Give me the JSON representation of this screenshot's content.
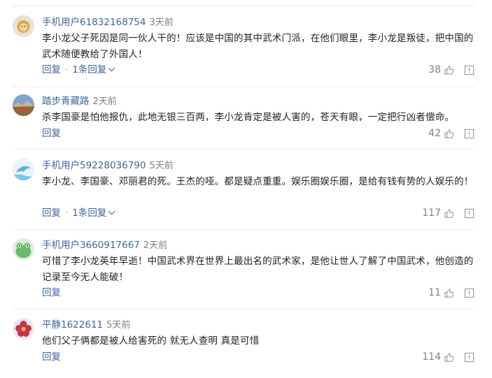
{
  "colors": {
    "link": "#406599",
    "meta": "#7f7f7f",
    "text": "#222222",
    "separator": "#ececec"
  },
  "comments": [
    {
      "user": "手机用户61832168754",
      "time": "3天前",
      "avatar_icon": "lion-avatar-icon",
      "text": "李小龙父子死因是同一伙人干的！应该是中国的其中武术门派，在他们眼里，李小龙是叛徒，把中国的武术随便教给了外国人！",
      "reply_label": "回复",
      "replies_label": "1条回复",
      "likes": "38"
    },
    {
      "user": "踏步青藏路",
      "time": "2天前",
      "avatar_icon": "landscape-avatar-icon",
      "text": "杀李国豪是怕他报仇，此地无银三百两，李小龙肯定是被人害的，苍天有眼，一定把行凶者偿命。",
      "reply_label": "回复",
      "replies_label": "",
      "likes": "42"
    },
    {
      "user": "手机用户59228036790",
      "time": "5天前",
      "avatar_icon": "dolphin-avatar-icon",
      "text": "李小龙、李国豪、邓丽君的死。王杰的哑。都是疑点重重。娱乐圈娱乐圈，是给有钱有势的人娱乐的！",
      "reply_label": "回复",
      "replies_label": "1条回复",
      "likes": "117"
    },
    {
      "user": "手机用户3660917667",
      "time": "2天前",
      "avatar_icon": "frog-avatar-icon",
      "text": "可惜了李小龙英年早逝！中国武术界在世界上最出名的武术家，是他让世人了解了中国武术，他创造的记录至今无人能破！",
      "reply_label": "回复",
      "replies_label": "",
      "likes": "11"
    },
    {
      "user": "平静1622611",
      "time": "5天前",
      "avatar_icon": "flower-avatar-icon",
      "text": "他们父子俩都是被人给害死的 就无人查明 真是可惜",
      "reply_label": "回复",
      "replies_label": "",
      "likes": "114"
    }
  ]
}
